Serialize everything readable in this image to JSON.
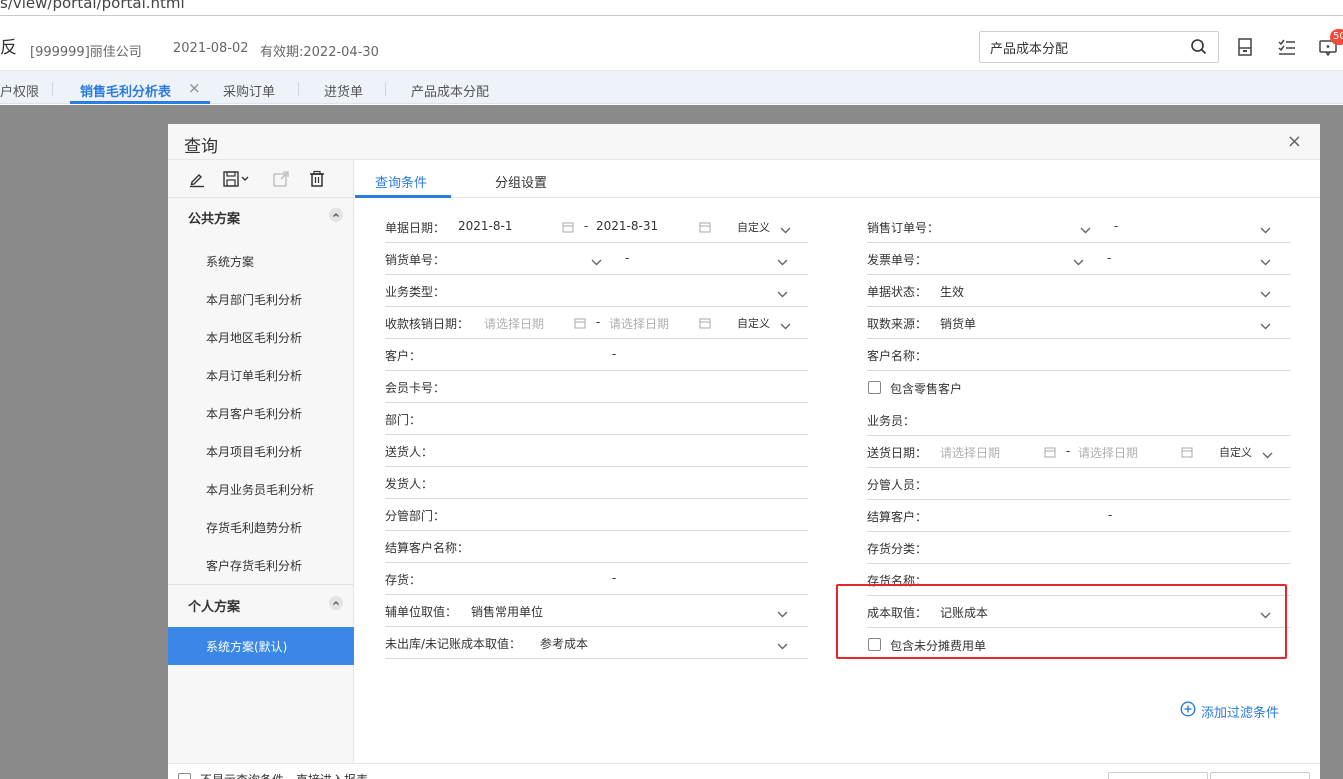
{
  "browser": {
    "url_fragment": "s/view/portal/portal.html"
  },
  "header": {
    "title_fragment": "反",
    "company": "[999999]丽佳公司",
    "date": "2021-08-02",
    "validity": "有效期:2022-04-30",
    "search_value": "产品成本分配",
    "badge": "50"
  },
  "tabs": [
    {
      "label": "户权限"
    },
    {
      "label": "销售毛利分析表"
    },
    {
      "label": "采购订单"
    },
    {
      "label": "进货单"
    },
    {
      "label": "产品成本分配"
    }
  ],
  "dialog": {
    "title": "查询",
    "close": "×",
    "sidebar": {
      "public_section": "公共方案",
      "public_items": [
        "系统方案",
        "本月部门毛利分析",
        "本月地区毛利分析",
        "本月订单毛利分析",
        "本月客户毛利分析",
        "本月项目毛利分析",
        "本月业务员毛利分析",
        "存货毛利趋势分析",
        "客户存货毛利分析"
      ],
      "personal_section": "个人方案",
      "personal_items": [
        "系统方案(默认)"
      ]
    },
    "main_tabs": [
      "查询条件",
      "分组设置"
    ],
    "left_fields": {
      "doc_date": {
        "label": "单据日期：",
        "from": "2021-8-1",
        "to": "2021-8-31",
        "mode": "自定义"
      },
      "sales_no": {
        "label": "销货单号："
      },
      "biz_type": {
        "label": "业务类型："
      },
      "settle_date": {
        "label": "收款核销日期：",
        "from_ph": "请选择日期",
        "to_ph": "请选择日期",
        "mode": "自定义"
      },
      "customer": {
        "label": "客户："
      },
      "member_card": {
        "label": "会员卡号："
      },
      "dept": {
        "label": "部门："
      },
      "deliverer": {
        "label": "送货人："
      },
      "shipper": {
        "label": "发货人："
      },
      "mgmt_dept": {
        "label": "分管部门："
      },
      "settle_cust_name": {
        "label": "结算客户名称："
      },
      "inventory": {
        "label": "存货："
      },
      "aux_unit": {
        "label": "辅单位取值：",
        "value": "销售常用单位"
      },
      "unposted_cost": {
        "label": "未出库/未记账成本取值：",
        "value": "参考成本"
      }
    },
    "right_fields": {
      "sales_order_no": {
        "label": "销售订单号："
      },
      "invoice_no": {
        "label": "发票单号："
      },
      "doc_status": {
        "label": "单据状态：",
        "value": "生效"
      },
      "fetch_source": {
        "label": "取数来源：",
        "value": "销货单"
      },
      "customer_name": {
        "label": "客户名称："
      },
      "include_retail": {
        "label": "包含零售客户"
      },
      "salesman": {
        "label": "业务员："
      },
      "delivery_date": {
        "label": "送货日期：",
        "from_ph": "请选择日期",
        "to_ph": "请选择日期",
        "mode": "自定义"
      },
      "mgmt_person": {
        "label": "分管人员："
      },
      "settle_customer": {
        "label": "结算客户："
      },
      "inv_category": {
        "label": "存货分类："
      },
      "inv_name": {
        "label": "存货名称："
      },
      "cost_value": {
        "label": "成本取值：",
        "value": "记账成本"
      },
      "include_unalloc": {
        "label": "包含未分摊费用单"
      }
    },
    "add_filter": "添加过滤条件",
    "footer_text": "不显示查询条件，直接进入报表"
  }
}
